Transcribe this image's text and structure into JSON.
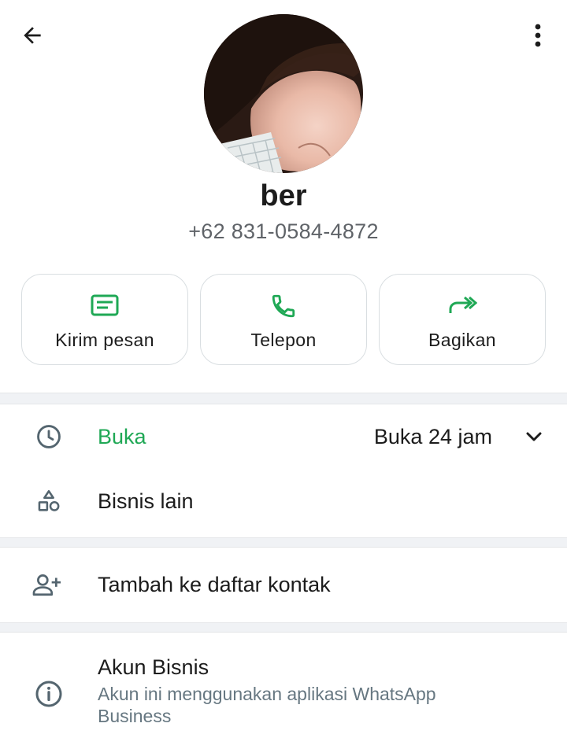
{
  "header": {
    "back_icon": "arrow-left-icon",
    "more_icon": "more-vertical-icon"
  },
  "profile": {
    "name": "ber",
    "phone": "+62 831-0584-4872"
  },
  "actions": [
    {
      "label": "Kirim pesan",
      "icon": "message-icon"
    },
    {
      "label": "Telepon",
      "icon": "phone-icon"
    },
    {
      "label": "Bagikan",
      "icon": "share-icon"
    }
  ],
  "business_hours": {
    "status": "Buka",
    "value": "Buka 24 jam",
    "icon": "clock-icon"
  },
  "other_business": {
    "label": "Bisnis lain",
    "icon": "shapes-icon"
  },
  "add_contact": {
    "label": "Tambah ke daftar kontak",
    "icon": "add-person-icon"
  },
  "business_account": {
    "title": "Akun Bisnis",
    "description": "Akun ini menggunakan aplikasi WhatsApp Business",
    "icon": "info-icon"
  },
  "colors": {
    "accent_green": "#1fa855",
    "text_primary": "#1c1c1c",
    "text_secondary": "#5f6368",
    "icon_gray": "#54656f"
  }
}
